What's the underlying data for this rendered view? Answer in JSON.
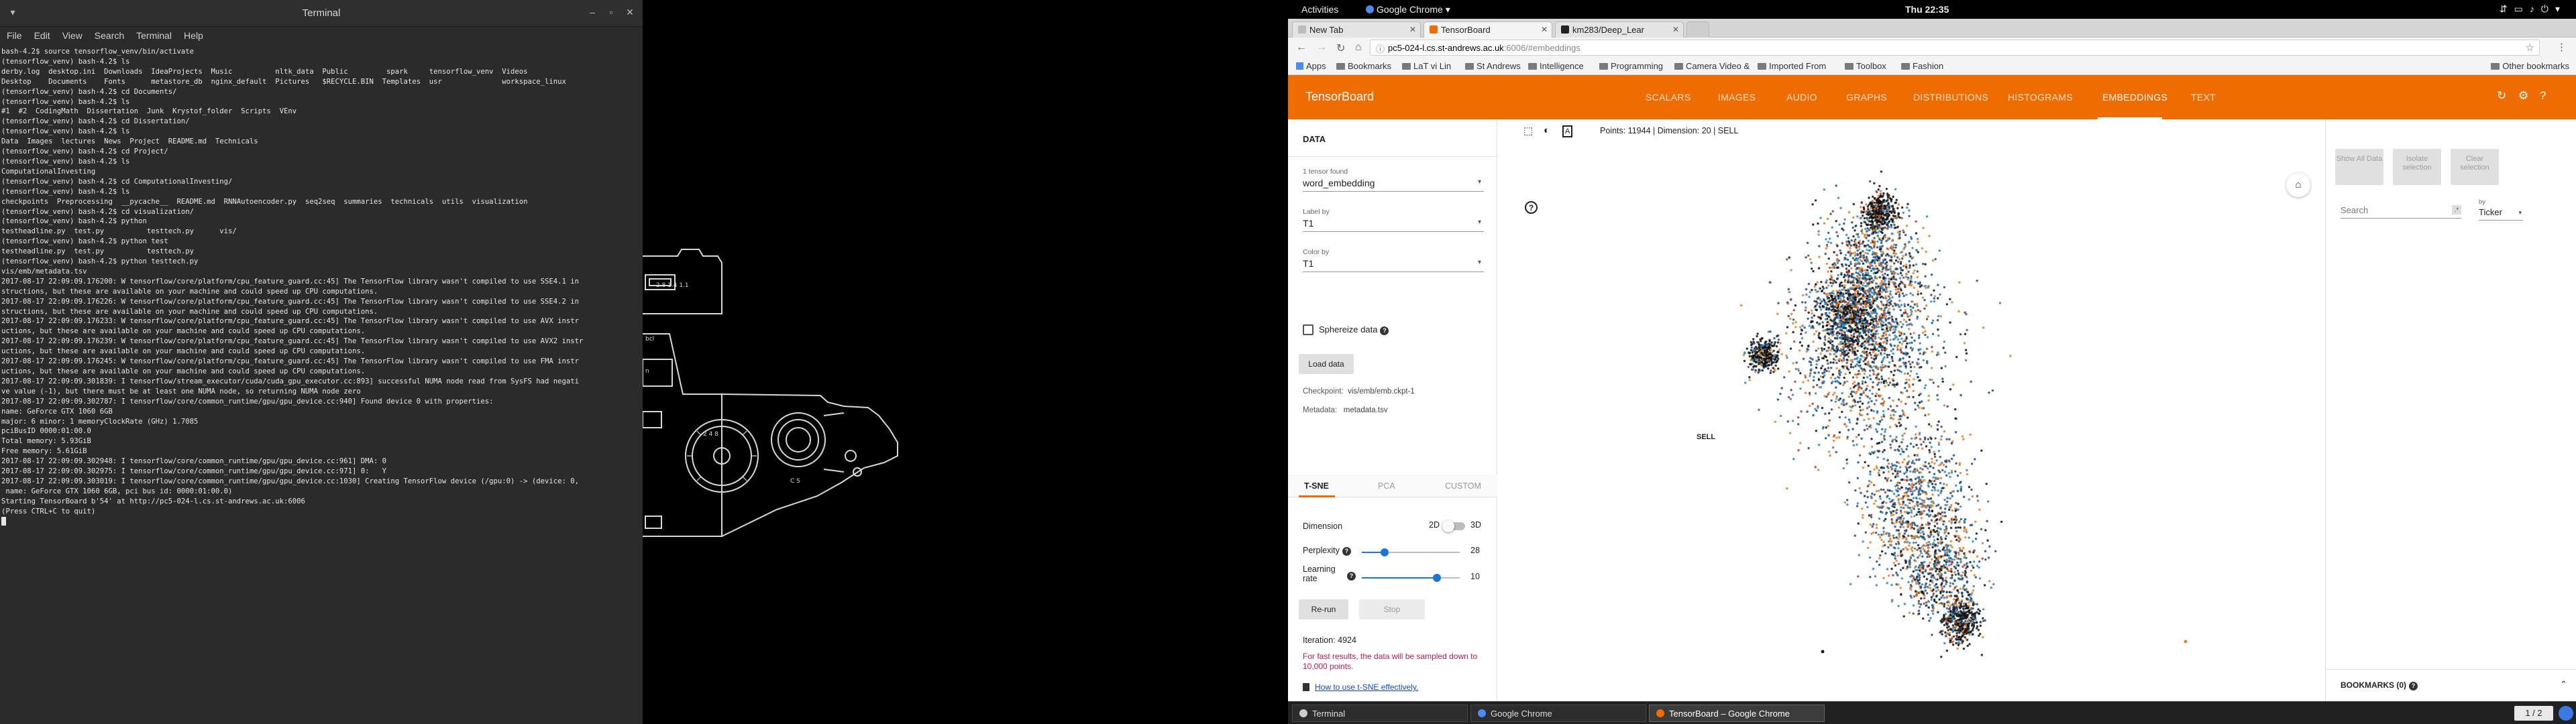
{
  "terminal": {
    "title": "Terminal",
    "menu": [
      "File",
      "Edit",
      "View",
      "Search",
      "Terminal",
      "Help"
    ],
    "lines": [
      "bash-4.2$ source tensorflow_venv/bin/activate",
      "(tensorflow_venv) bash-4.2$ ls",
      "derby.log  desktop.ini  Downloads  IdeaProjects  Music          nltk_data  Public         spark     tensorflow_venv  Videos",
      "Desktop    Documents    Fonts      metastore_db  nginx_default  Pictures   $RECYCLE.BIN  Templates  usr              workspace_linux",
      "(tensorflow_venv) bash-4.2$ cd Documents/",
      "(tensorflow_venv) bash-4.2$ ls",
      "#1  #2  CodingMath  Dissertation  Junk  Krystof_folder  Scripts  VEnv",
      "(tensorflow_venv) bash-4.2$ cd Dissertation/",
      "(tensorflow_venv) bash-4.2$ ls",
      "Data  Images  lectures  News  Project  README.md  Technicals",
      "(tensorflow_venv) bash-4.2$ cd Project/",
      "(tensorflow_venv) bash-4.2$ ls",
      "ComputationalInvesting",
      "(tensorflow_venv) bash-4.2$ cd ComputationalInvesting/",
      "(tensorflow_venv) bash-4.2$ ls",
      "checkpoints  Preprocessing  __pycache__  README.md  RNNAutoencoder.py  seq2seq  summaries  technicals  utils  visualization",
      "(tensorflow_venv) bash-4.2$ cd visualization/",
      "(tensorflow_venv) bash-4.2$ python",
      "testheadline.py  test.py          testtech.py      vis/",
      "(tensorflow_venv) bash-4.2$ python test",
      "testheadline.py  test.py          testtech.py",
      "(tensorflow_venv) bash-4.2$ python testtech.py",
      "vis/emb/metadata.tsv",
      "2017-08-17 22:09:09.176200: W tensorflow/core/platform/cpu_feature_guard.cc:45] The TensorFlow library wasn't compiled to use SSE4.1 in",
      "structions, but these are available on your machine and could speed up CPU computations.",
      "2017-08-17 22:09:09.176226: W tensorflow/core/platform/cpu_feature_guard.cc:45] The TensorFlow library wasn't compiled to use SSE4.2 in",
      "structions, but these are available on your machine and could speed up CPU computations.",
      "2017-08-17 22:09:09.176233: W tensorflow/core/platform/cpu_feature_guard.cc:45] The TensorFlow library wasn't compiled to use AVX instr",
      "uctions, but these are available on your machine and could speed up CPU computations.",
      "2017-08-17 22:09:09.176239: W tensorflow/core/platform/cpu_feature_guard.cc:45] The TensorFlow library wasn't compiled to use AVX2 instr",
      "uctions, but these are available on your machine and could speed up CPU computations.",
      "2017-08-17 22:09:09.176245: W tensorflow/core/platform/cpu_feature_guard.cc:45] The TensorFlow library wasn't compiled to use FMA instr",
      "uctions, but these are available on your machine and could speed up CPU computations.",
      "2017-08-17 22:09:09.301839: I tensorflow/stream_executor/cuda/cuda_gpu_executor.cc:893] successful NUMA node read from SysFS had negati",
      "ve value (-1), but there must be at least one NUMA node, so returning NUMA node zero",
      "2017-08-17 22:09:09.302787: I tensorflow/core/common_runtime/gpu/gpu_device.cc:940] Found device 0 with properties:",
      "name: GeForce GTX 1060 6GB",
      "major: 6 minor: 1 memoryClockRate (GHz) 1.7085",
      "pciBusID 0000:01:00.0",
      "Total memory: 5.93GiB",
      "Free memory: 5.61GiB",
      "2017-08-17 22:09:09.302948: I tensorflow/core/common_runtime/gpu/gpu_device.cc:961] DMA: 0",
      "2017-08-17 22:09:09.302975: I tensorflow/core/common_runtime/gpu/gpu_device.cc:971] 0:   Y",
      "2017-08-17 22:09:09.303019: I tensorflow/core/common_runtime/gpu/gpu_device.cc:1030] Creating TensorFlow device (/gpu:0) -> (device: 0,",
      " name: GeForce GTX 1060 6GB, pci bus id: 0000:01:00.0)",
      "Starting TensorBoard b'54' at http://pc5-024-l.cs.st-andrews.ac.uk:6006",
      "(Press CTRL+C to quit)"
    ]
  },
  "topbar": {
    "activities": "Activities",
    "app": "Google Chrome",
    "clock": "Thu 22:35"
  },
  "chrome": {
    "tabs": [
      {
        "label": "New Tab",
        "fav": "#bdbdbd"
      },
      {
        "label": "TensorBoard",
        "fav": "#ef6c00"
      },
      {
        "label": "km283/Deep_Lear",
        "fav": "#222222"
      }
    ],
    "url_host": "pc5-024-l.cs.st-andrews.ac.uk",
    "url_path": ":6006/#embeddings",
    "bookmarks": [
      "Apps",
      "Bookmarks",
      "LaT vi Lin",
      "St Andrews",
      "Intelligence",
      "Programming",
      "Camera Video &",
      "Imported From",
      "Toolbox",
      "Fashion"
    ],
    "other_bookmarks": "Other bookmarks"
  },
  "tensorboard": {
    "logo": "TensorBoard",
    "tabs": [
      "SCALARS",
      "IMAGES",
      "AUDIO",
      "GRAPHS",
      "DISTRIBUTIONS",
      "HISTOGRAMS",
      "EMBEDDINGS",
      "TEXT"
    ],
    "active_tab": "EMBEDDINGS",
    "left": {
      "heading": "DATA",
      "tensors_label": "1 tensor found",
      "tensors_value": "word_embedding",
      "label_by_label": "Label by",
      "label_by_value": "T1",
      "color_by_label": "Color by",
      "color_by_value": "T1",
      "sphereize": "Sphereize data",
      "load_data": "Load data",
      "checkpoint_label": "Checkpoint:",
      "checkpoint_value": "vis/emb/emb.ckpt-1",
      "metadata_label": "Metadata:",
      "metadata_value": "metadata.tsv",
      "methods": [
        "T-SNE",
        "PCA",
        "CUSTOM"
      ],
      "dimension_label": "Dimension",
      "dim_2d": "2D",
      "dim_3d": "3D",
      "perplexity_label": "Perplexity",
      "perplexity_value": "28",
      "learning_rate_label": "Learning rate",
      "learning_rate_value": "10",
      "rerun": "Re-run",
      "stop": "Stop",
      "iteration": "Iteration: 4924",
      "fast_note": "For fast results, the data will be sampled down to 10,000 points.",
      "tsne_link": "How to use t-SNE effectively."
    },
    "projector": {
      "points_info": "Points: 11944 | Dimension: 20 | SELL",
      "label_text": "SELL",
      "colors": [
        "#1f4e79",
        "#2e86c1",
        "#e67e22",
        "#111111",
        "#b03a2e"
      ]
    },
    "right": {
      "show_all": "Show All Data",
      "isolate": "Isolate selection",
      "clear": "Clear selection",
      "search_placeholder": "Search",
      "by_label": "by",
      "by_value": "Ticker",
      "bookmarks": "BOOKMARKS (0)"
    }
  },
  "taskbar": {
    "items": [
      {
        "label": "Terminal",
        "color": "#cccccc"
      },
      {
        "label": "Google Chrome",
        "color": "#4a8af4"
      },
      {
        "label": "TensorBoard – Google Chrome",
        "color": "#ef6c00"
      }
    ],
    "workspace": "1 / 2"
  }
}
